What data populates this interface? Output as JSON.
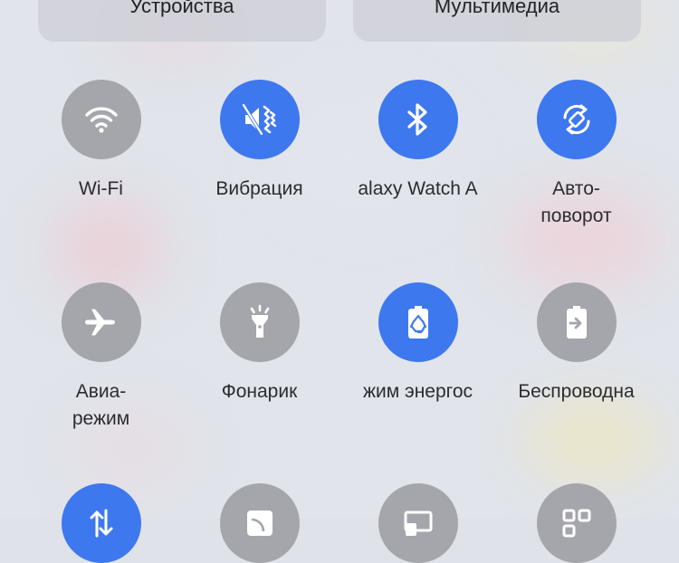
{
  "top_buttons": {
    "devices": "Устройства",
    "media": "Мультимедиа"
  },
  "colors": {
    "active": "#3e78ee",
    "inactive": "#a4a6ab",
    "text": "#2a2c31"
  },
  "tiles": [
    {
      "line1": "Wi-Fi",
      "line2": "",
      "state": "off",
      "icon": "wifi-icon"
    },
    {
      "line1": "Вибрация",
      "line2": "",
      "state": "on",
      "icon": "vibrate-icon"
    },
    {
      "line1": "alaxy Watch A",
      "line2": "",
      "state": "on",
      "icon": "bluetooth-icon"
    },
    {
      "line1": "Авто-",
      "line2": "поворот",
      "state": "on",
      "icon": "auto-rotate-icon"
    },
    {
      "line1": "Авиа-",
      "line2": "режим",
      "state": "off",
      "icon": "airplane-icon"
    },
    {
      "line1": "Фонарик",
      "line2": "",
      "state": "off",
      "icon": "flashlight-icon"
    },
    {
      "line1": "жим энергос",
      "line2": "",
      "state": "on",
      "icon": "power-saving-icon"
    },
    {
      "line1": "Беспроводна",
      "line2": "",
      "state": "off",
      "icon": "wireless-powershare-icon"
    },
    {
      "state": "on",
      "icon": "mobile-data-icon"
    },
    {
      "state": "off",
      "icon": "cast-icon"
    },
    {
      "state": "off",
      "icon": "screen-share-icon"
    },
    {
      "state": "off",
      "icon": "qr-scanner-icon"
    }
  ]
}
